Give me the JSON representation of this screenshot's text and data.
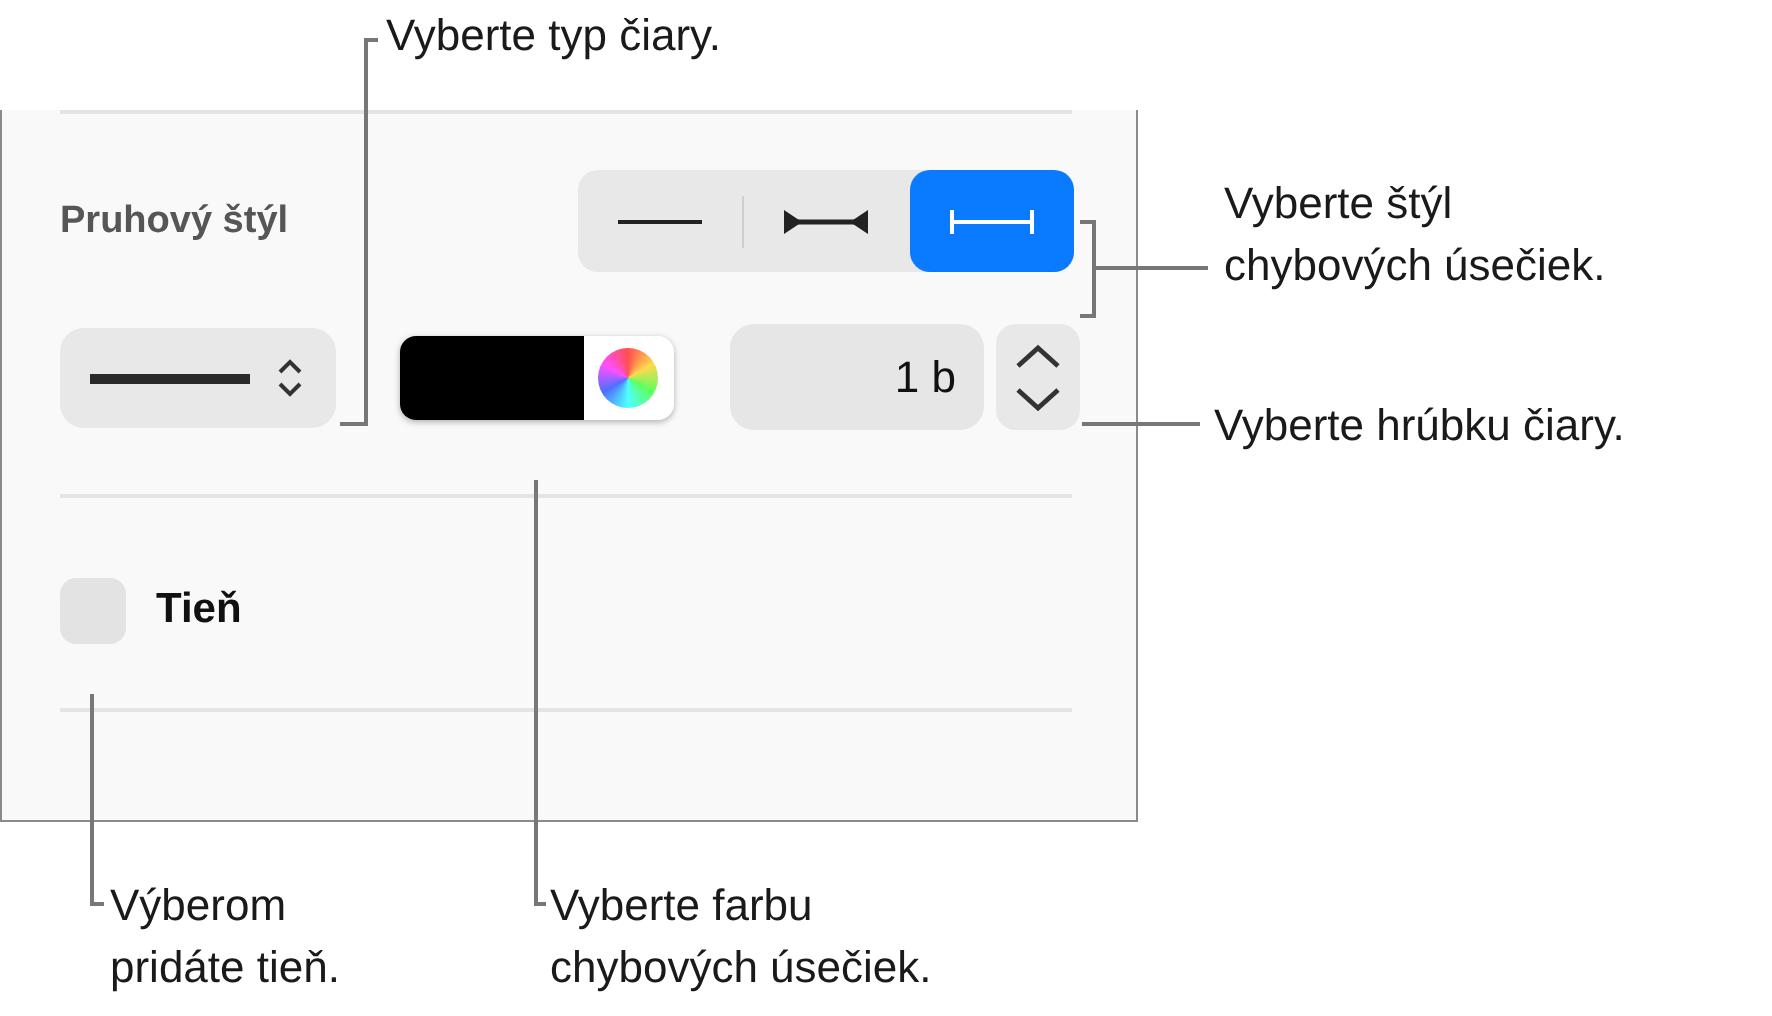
{
  "panel": {
    "bar_style_label": "Pruhový štýl",
    "bar_styles": [
      {
        "kind": "line",
        "selected": false
      },
      {
        "kind": "arrows",
        "selected": false
      },
      {
        "kind": "caps",
        "selected": true
      }
    ],
    "line_width": {
      "value": "1 b"
    },
    "shadow": {
      "label": "Tieň",
      "checked": false
    }
  },
  "callouts": [
    {
      "kind": "line-type",
      "lines": [
        "Vyberte typ čiary."
      ]
    },
    {
      "kind": "bar-style",
      "lines": [
        "Vyberte štýl",
        "chybových úsečiek."
      ]
    },
    {
      "kind": "thickness",
      "lines": [
        "Vyberte hrúbku čiary."
      ]
    },
    {
      "kind": "shadow",
      "lines": [
        "Výberom",
        "pridáte tieň."
      ]
    },
    {
      "kind": "color",
      "lines": [
        "Vyberte farbu",
        "chybových úsečiek."
      ]
    }
  ]
}
